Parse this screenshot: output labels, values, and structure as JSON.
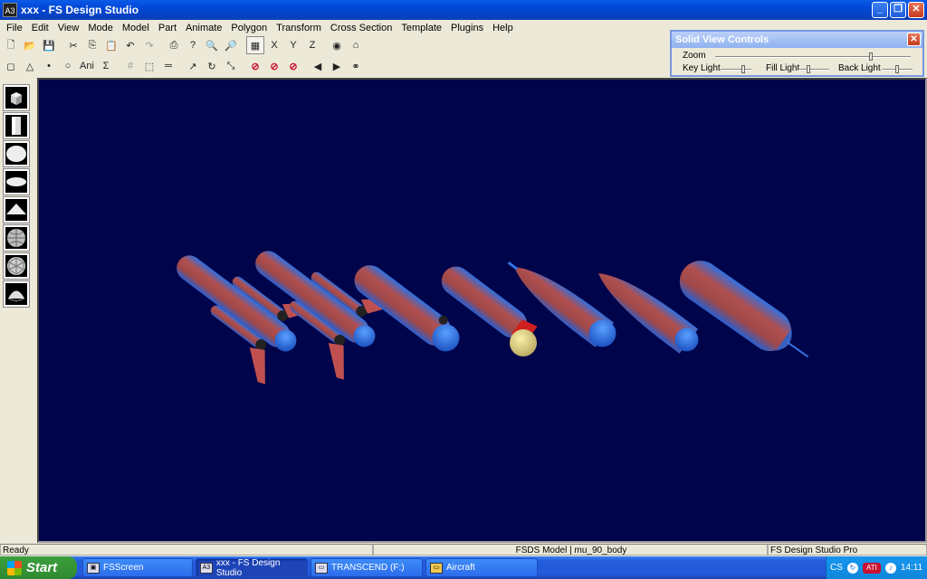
{
  "window": {
    "title": "xxx - FS Design Studio",
    "app_icon": "A3",
    "buttons": [
      "_",
      "❐",
      "✕"
    ]
  },
  "menu": [
    "File",
    "Edit",
    "View",
    "Mode",
    "Model",
    "Part",
    "Animate",
    "Polygon",
    "Transform",
    "Cross Section",
    "Template",
    "Plugins",
    "Help"
  ],
  "toolbar1": [
    {
      "name": "new-icon",
      "glyph": "🗋"
    },
    {
      "name": "open-icon",
      "glyph": "📂"
    },
    {
      "name": "save-icon",
      "glyph": "💾"
    },
    {
      "name": "cut-icon",
      "glyph": "✂"
    },
    {
      "name": "copy-icon",
      "glyph": "⎘"
    },
    {
      "name": "paste-icon",
      "glyph": "📋"
    },
    {
      "name": "undo-icon",
      "glyph": "↶"
    },
    {
      "name": "redo-icon",
      "glyph": "↷"
    },
    {
      "name": "print-icon",
      "glyph": "⎙"
    },
    {
      "name": "help-icon",
      "glyph": "?"
    },
    {
      "name": "zoom-in-icon",
      "glyph": "🔍"
    },
    {
      "name": "zoom-out-icon",
      "glyph": "🔎"
    },
    {
      "name": "grid-icon",
      "glyph": "▦"
    },
    {
      "name": "axis-x-icon",
      "glyph": "X"
    },
    {
      "name": "axis-y-icon",
      "glyph": "Y"
    },
    {
      "name": "axis-z-icon",
      "glyph": "Z"
    },
    {
      "name": "solid-view-icon",
      "glyph": "◉"
    },
    {
      "name": "home-view-icon",
      "glyph": "⌂"
    }
  ],
  "toolbar2": [
    {
      "name": "select-icon",
      "glyph": "◻"
    },
    {
      "name": "triangle-icon",
      "glyph": "△"
    },
    {
      "name": "point-icon",
      "glyph": "•"
    },
    {
      "name": "circle-icon",
      "glyph": "○"
    },
    {
      "name": "animation-icon",
      "glyph": "Ani"
    },
    {
      "name": "sum-icon",
      "glyph": "Σ"
    },
    {
      "name": "numbers-icon",
      "glyph": "#"
    },
    {
      "name": "marquee-icon",
      "glyph": "⬚"
    },
    {
      "name": "ruler-icon",
      "glyph": "═"
    },
    {
      "name": "arrow-icon",
      "glyph": "↗"
    },
    {
      "name": "rotate-icon",
      "glyph": "↻"
    },
    {
      "name": "scale-icon",
      "glyph": "⤡"
    },
    {
      "name": "no-move-icon",
      "glyph": "⊘"
    },
    {
      "name": "no-rotate-icon",
      "glyph": "⊘"
    },
    {
      "name": "no-scale-icon",
      "glyph": "⊘"
    },
    {
      "name": "prev-icon",
      "glyph": "◀"
    },
    {
      "name": "next-icon",
      "glyph": "▶"
    },
    {
      "name": "binoculars-icon",
      "glyph": "⚭"
    }
  ],
  "solid_view_controls": {
    "title": "Solid View Controls",
    "zoom_label": "Zoom",
    "key_light_label": "Key Light",
    "fill_light_label": "Fill Light",
    "back_light_label": "Back Light",
    "zoom_level": 0.8,
    "key_light_level": 0.75,
    "fill_light_level": 0.3,
    "back_light_level": 0.5
  },
  "shapes": [
    "cube-icon",
    "cylinder-icon",
    "sphere-icon",
    "ellipsoid-icon",
    "cone-icon",
    "globe-icon",
    "geosphere-icon",
    "dome-icon"
  ],
  "viewport": {
    "background": "#00044A",
    "body_color": "#B04E4E",
    "nose_color": "#2A6FE0"
  },
  "status": {
    "left": "Ready",
    "model": "FSDS Model | mu_90_body",
    "product": "FS Design Studio Pro"
  },
  "taskbar": {
    "start": "Start",
    "tasks": [
      {
        "label": "FSScreen",
        "icon": "▣"
      },
      {
        "label": "xxx - FS Design Studio",
        "icon": "A3",
        "active": true
      },
      {
        "label": "TRANSCEND (F:)",
        "icon": "▭"
      },
      {
        "label": "Aircraft",
        "icon": "▭"
      }
    ],
    "tray_lang": "CS",
    "tray_ati": "ATI",
    "clock": "14:11"
  }
}
